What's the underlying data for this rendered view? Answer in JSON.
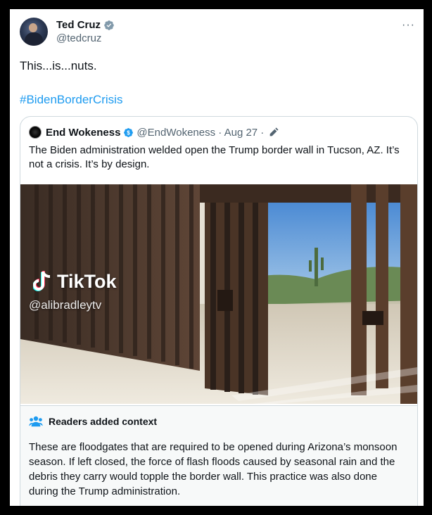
{
  "tweet": {
    "author": {
      "display_name": "Ted Cruz",
      "handle": "@tedcruz",
      "verified_icon": "verified-badge-icon",
      "verified_color": "#1d9bf0"
    },
    "more_label": "···",
    "text": "This...is...nuts.",
    "hashtag": "#BidenBorderCrisis",
    "hashtag_color": "#1d9bf0"
  },
  "quote": {
    "author": {
      "display_name": "End Wokeness",
      "handle": "@EndWokeness",
      "verified_icon": "verified-dollar-badge-icon"
    },
    "meta": "@EndWokeness · Aug 27 ·",
    "text": "The Biden administration welded open the Trump border wall in Tucson, AZ. It’s not a crisis. It’s by design.",
    "media": {
      "watermark_brand": "TikTok",
      "watermark_handle": "@alibradleytv"
    }
  },
  "community_note": {
    "icon": "people-icon",
    "title": "Readers added context",
    "text": "These are floodgates that are required to be opened during Arizona’s monsoon season. If left closed, the force of flash floods caused by seasonal rain and the debris they carry would topple the border wall. This practice was also done during the Trump administration."
  }
}
